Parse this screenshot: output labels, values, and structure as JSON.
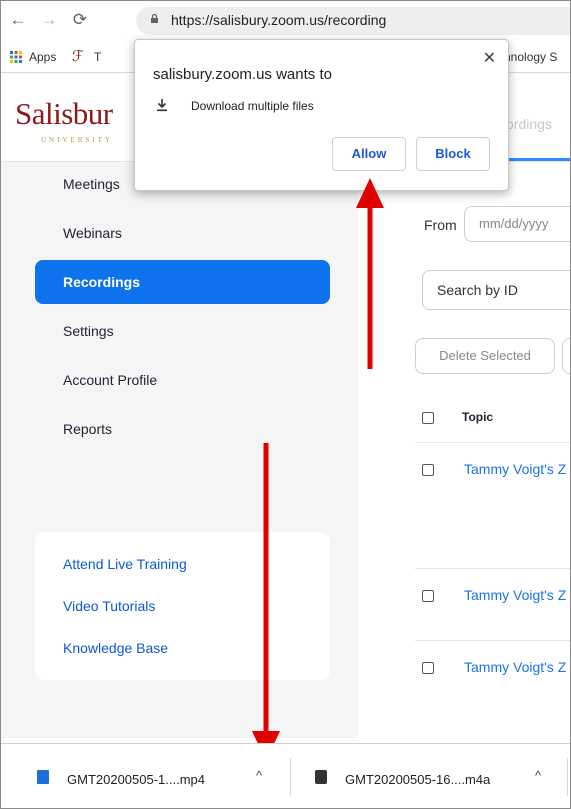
{
  "browser": {
    "url": "https://salisbury.zoom.us/recording",
    "bookmarks": {
      "apps_label": "Apps",
      "item_t": "T",
      "item_tech": "hnology S"
    }
  },
  "header": {
    "logo_text": "Salisbur",
    "logo_sub": "UNIVERSITY",
    "tab_label": "ordings"
  },
  "sidebar": {
    "items": [
      {
        "label": "Meetings"
      },
      {
        "label": "Webinars"
      },
      {
        "label": "Recordings",
        "active": true
      },
      {
        "label": "Settings"
      },
      {
        "label": "Account Profile"
      },
      {
        "label": "Reports"
      }
    ],
    "help_links": [
      {
        "label": "Attend Live Training"
      },
      {
        "label": "Video Tutorials"
      },
      {
        "label": "Knowledge Base"
      }
    ]
  },
  "main": {
    "from_label": "From",
    "date_placeholder": "mm/dd/yyyy",
    "search_select_value": "Search by ID",
    "delete_button": "Delete Selected",
    "topic_header": "Topic",
    "recordings": [
      {
        "topic": "Tammy Voigt's Z"
      },
      {
        "topic": "Tammy Voigt's Z"
      },
      {
        "topic": "Tammy Voigt's Z"
      }
    ]
  },
  "popup": {
    "title": "salisbury.zoom.us wants to",
    "permission": "Download multiple files",
    "allow_button": "Allow",
    "block_button": "Block",
    "close_icon": "close-icon"
  },
  "download_bar": {
    "items": [
      {
        "filename": "GMT20200505-1....mp4",
        "icon": "video-file-icon"
      },
      {
        "filename": "GMT20200505-16....m4a",
        "icon": "audio-file-icon"
      }
    ]
  },
  "colors": {
    "active_nav": "#0e72ed",
    "link": "#1a73e8",
    "annotation_arrow": "#e00000",
    "brand": "#8b1a1a"
  }
}
